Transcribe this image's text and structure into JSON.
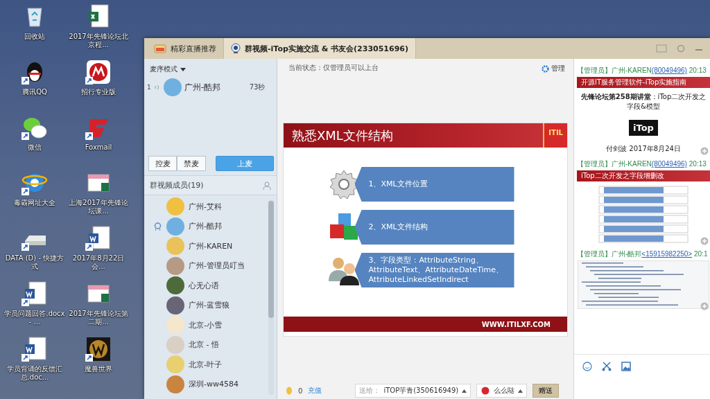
{
  "desktop": {
    "icons": [
      {
        "label": "回收站",
        "kind": "recycle",
        "shortcut": false
      },
      {
        "label": "2017年先锋论坛北京程...",
        "kind": "excel",
        "shortcut": false
      },
      {
        "label": "腾讯QQ",
        "kind": "qq",
        "shortcut": true
      },
      {
        "label": "招行专业版",
        "kind": "bank",
        "shortcut": true
      },
      {
        "label": "微信",
        "kind": "wechat",
        "shortcut": true
      },
      {
        "label": "Foxmail",
        "kind": "mail",
        "shortcut": true
      },
      {
        "label": "毒霸网址大全",
        "kind": "browser",
        "shortcut": true
      },
      {
        "label": "上海2017年先锋论坛课...",
        "kind": "sheet",
        "shortcut": false
      },
      {
        "label": "DATA (D) - 快捷方式",
        "kind": "drive",
        "shortcut": true
      },
      {
        "label": "2017年8月22日会...",
        "kind": "word",
        "shortcut": true
      },
      {
        "label": "学员问题回答.docx - ...",
        "kind": "word",
        "shortcut": true
      },
      {
        "label": "2017年先锋论坛第二期...",
        "kind": "sheet",
        "shortcut": false
      },
      {
        "label": "学员背诵的反馈汇总.doc...",
        "kind": "word",
        "shortcut": true
      },
      {
        "label": "魔兽世界",
        "kind": "game",
        "shortcut": true
      }
    ]
  },
  "window": {
    "tabs": [
      {
        "label": "精彩直播推荐",
        "kind": "live",
        "selected": false
      },
      {
        "label": "群视频-iTop实施交流 & 书友会(233051696)",
        "kind": "video",
        "selected": true
      }
    ]
  },
  "left_panel": {
    "mode": "麦序模式",
    "queue": [
      {
        "index": "1",
        "name": "广州-酷邦",
        "time": "73秒"
      }
    ],
    "buttons": [
      {
        "label": "控麦",
        "primary": false
      },
      {
        "label": "禁麦",
        "primary": false
      },
      {
        "label": "上麦",
        "primary": true
      }
    ],
    "members_title": "群视频成员(19)",
    "members": [
      {
        "name": "广州-艾科",
        "host": false
      },
      {
        "name": "广州-酷邦",
        "host": true
      },
      {
        "name": "广州-KAREN",
        "host": false
      },
      {
        "name": "广州-管理员叮当",
        "host": false
      },
      {
        "name": "心无心语",
        "host": false
      },
      {
        "name": "广州-蓝雪狼",
        "host": false
      },
      {
        "name": "北京-小雪",
        "host": false
      },
      {
        "name": "北京 - 悟",
        "host": false
      },
      {
        "name": "北京-叶子",
        "host": false
      },
      {
        "name": "深圳-ww4584",
        "host": false
      }
    ]
  },
  "stage": {
    "status": "当前状态：仅管理员可以上台",
    "manage": "管理",
    "slide": {
      "title": "熟悉XML文件结构",
      "logo": "ITIL",
      "footer": "WWW.ITILXF.COM",
      "items": [
        {
          "kind": "gear",
          "text": "1、XML文件位置"
        },
        {
          "kind": "cubes",
          "text": "2、XML文件结构"
        },
        {
          "kind": "people",
          "text": "3、字段类型：AttributeString、AttributeText、AttributeDateTime、AttributeLinkedSetIndirect"
        }
      ]
    },
    "gift_bar": {
      "coins": "0",
      "recharge": "充值",
      "to_label": "送给：",
      "to_value": "iTOP芋青(350616949)",
      "gift": "么么哒",
      "send": "赠送"
    }
  },
  "chat": {
    "messages": [
      {
        "role": "【管理员】",
        "name": "广州-KAREN",
        "contact": "(80049496)",
        "time": "20:13",
        "attachment": {
          "kind": "cover",
          "banner": "开源IT服务管理软件-iTop实施指南",
          "subtitle": "**先锋论坛第258期讲堂**：iTop二次开发之字段&模型",
          "logo": "iTop",
          "caption": "付剑波 2017年8月24日"
        }
      },
      {
        "role": "【管理员】",
        "name": "广州-KAREN",
        "contact": "(80049496)",
        "time": "20:13",
        "attachment": {
          "kind": "table",
          "banner": "iTop二次开发之字段增删改"
        }
      },
      {
        "role": "【管理员】",
        "name": "广州-酷邦",
        "contact": "<15915982250>",
        "time": "20:1",
        "attachment": {
          "kind": "code"
        }
      }
    ]
  }
}
